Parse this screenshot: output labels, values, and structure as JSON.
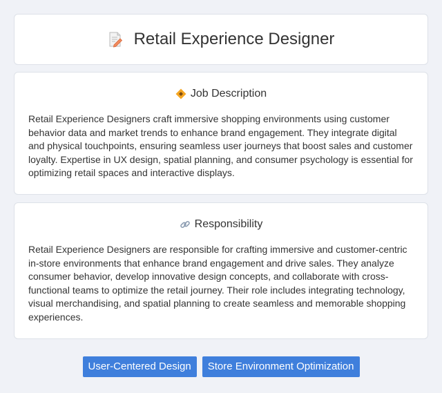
{
  "header": {
    "title": "Retail Experience Designer",
    "icon": "document-pencil-icon"
  },
  "job_description": {
    "title": "Job Description",
    "icon": "diamond-badge-icon",
    "text": "Retail Experience Designers craft immersive shopping environments using customer behavior data and market trends to enhance brand engagement. They integrate digital and physical touchpoints, ensuring seamless user journeys that boost sales and customer loyalty. Expertise in UX design, spatial planning, and consumer psychology is essential for optimizing retail spaces and interactive displays."
  },
  "responsibility": {
    "title": "Responsibility",
    "icon": "link-icon",
    "text": "Retail Experience Designers are responsible for crafting immersive and customer-centric in-store environments that enhance brand engagement and drive sales. They analyze consumer behavior, develop innovative design concepts, and collaborate with cross-functional teams to optimize the retail journey. Their role includes integrating technology, visual merchandising, and spatial planning to create seamless and memorable shopping experiences."
  },
  "tags": [
    {
      "label": "User-Centered Design"
    },
    {
      "label": "Store Environment Optimization"
    }
  ],
  "colors": {
    "background": "#f0f2f7",
    "card": "#ffffff",
    "tag": "#3f7fdc"
  }
}
